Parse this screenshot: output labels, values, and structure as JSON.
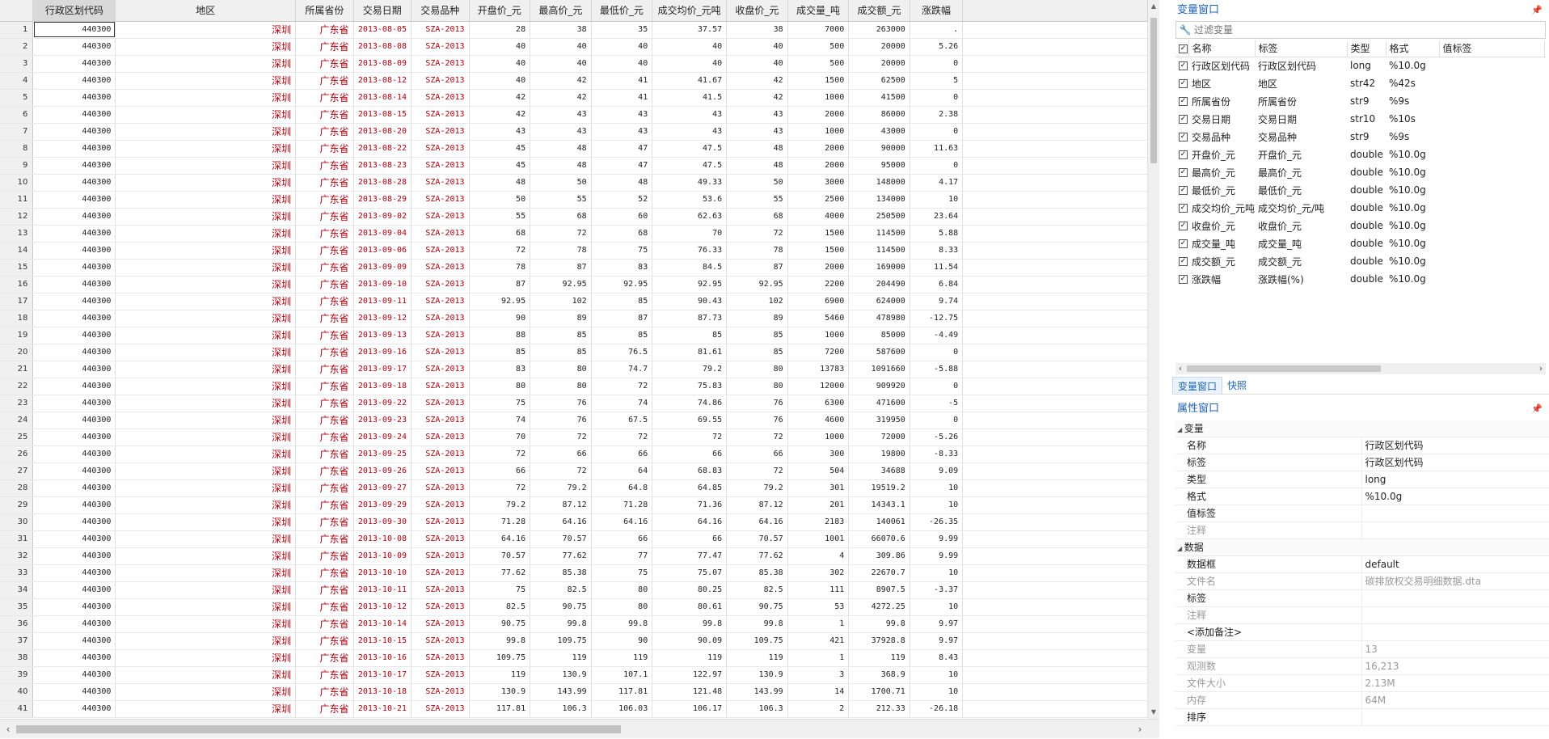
{
  "grid": {
    "columns": [
      "行政区划代码",
      "地区",
      "所属省份",
      "交易日期",
      "交易品种",
      "开盘价_元",
      "最高价_元",
      "最低价_元",
      "成交均价_元吨",
      "收盘价_元",
      "成交量_吨",
      "成交额_元",
      "涨跌幅"
    ],
    "rows": [
      [
        "1",
        "440300",
        "深圳",
        "广东省",
        "2013-08-05",
        "SZA-2013",
        "28",
        "38",
        "35",
        "37.57",
        "38",
        "7000",
        "263000",
        "."
      ],
      [
        "2",
        "440300",
        "深圳",
        "广东省",
        "2013-08-08",
        "SZA-2013",
        "40",
        "40",
        "40",
        "40",
        "40",
        "500",
        "20000",
        "5.26"
      ],
      [
        "3",
        "440300",
        "深圳",
        "广东省",
        "2013-08-09",
        "SZA-2013",
        "40",
        "40",
        "40",
        "40",
        "40",
        "500",
        "20000",
        "0"
      ],
      [
        "4",
        "440300",
        "深圳",
        "广东省",
        "2013-08-12",
        "SZA-2013",
        "40",
        "42",
        "41",
        "41.67",
        "42",
        "1500",
        "62500",
        "5"
      ],
      [
        "5",
        "440300",
        "深圳",
        "广东省",
        "2013-08-14",
        "SZA-2013",
        "42",
        "42",
        "41",
        "41.5",
        "42",
        "1000",
        "41500",
        "0"
      ],
      [
        "6",
        "440300",
        "深圳",
        "广东省",
        "2013-08-15",
        "SZA-2013",
        "42",
        "43",
        "43",
        "43",
        "43",
        "2000",
        "86000",
        "2.38"
      ],
      [
        "7",
        "440300",
        "深圳",
        "广东省",
        "2013-08-20",
        "SZA-2013",
        "43",
        "43",
        "43",
        "43",
        "43",
        "1000",
        "43000",
        "0"
      ],
      [
        "8",
        "440300",
        "深圳",
        "广东省",
        "2013-08-22",
        "SZA-2013",
        "45",
        "48",
        "47",
        "47.5",
        "48",
        "2000",
        "90000",
        "11.63"
      ],
      [
        "9",
        "440300",
        "深圳",
        "广东省",
        "2013-08-23",
        "SZA-2013",
        "45",
        "48",
        "47",
        "47.5",
        "48",
        "2000",
        "95000",
        "0"
      ],
      [
        "10",
        "440300",
        "深圳",
        "广东省",
        "2013-08-28",
        "SZA-2013",
        "48",
        "50",
        "48",
        "49.33",
        "50",
        "3000",
        "148000",
        "4.17"
      ],
      [
        "11",
        "440300",
        "深圳",
        "广东省",
        "2013-08-29",
        "SZA-2013",
        "50",
        "55",
        "52",
        "53.6",
        "55",
        "2500",
        "134000",
        "10"
      ],
      [
        "12",
        "440300",
        "深圳",
        "广东省",
        "2013-09-02",
        "SZA-2013",
        "55",
        "68",
        "60",
        "62.63",
        "68",
        "4000",
        "250500",
        "23.64"
      ],
      [
        "13",
        "440300",
        "深圳",
        "广东省",
        "2013-09-04",
        "SZA-2013",
        "68",
        "72",
        "68",
        "70",
        "72",
        "1500",
        "114500",
        "5.88"
      ],
      [
        "14",
        "440300",
        "深圳",
        "广东省",
        "2013-09-06",
        "SZA-2013",
        "72",
        "78",
        "75",
        "76.33",
        "78",
        "1500",
        "114500",
        "8.33"
      ],
      [
        "15",
        "440300",
        "深圳",
        "广东省",
        "2013-09-09",
        "SZA-2013",
        "78",
        "87",
        "83",
        "84.5",
        "87",
        "2000",
        "169000",
        "11.54"
      ],
      [
        "16",
        "440300",
        "深圳",
        "广东省",
        "2013-09-10",
        "SZA-2013",
        "87",
        "92.95",
        "92.95",
        "92.95",
        "92.95",
        "2200",
        "204490",
        "6.84"
      ],
      [
        "17",
        "440300",
        "深圳",
        "广东省",
        "2013-09-11",
        "SZA-2013",
        "92.95",
        "102",
        "85",
        "90.43",
        "102",
        "6900",
        "624000",
        "9.74"
      ],
      [
        "18",
        "440300",
        "深圳",
        "广东省",
        "2013-09-12",
        "SZA-2013",
        "90",
        "89",
        "87",
        "87.73",
        "89",
        "5460",
        "478980",
        "-12.75"
      ],
      [
        "19",
        "440300",
        "深圳",
        "广东省",
        "2013-09-13",
        "SZA-2013",
        "88",
        "85",
        "85",
        "85",
        "85",
        "1000",
        "85000",
        "-4.49"
      ],
      [
        "20",
        "440300",
        "深圳",
        "广东省",
        "2013-09-16",
        "SZA-2013",
        "85",
        "85",
        "76.5",
        "81.61",
        "85",
        "7200",
        "587600",
        "0"
      ],
      [
        "21",
        "440300",
        "深圳",
        "广东省",
        "2013-09-17",
        "SZA-2013",
        "83",
        "80",
        "74.7",
        "79.2",
        "80",
        "13783",
        "1091660",
        "-5.88"
      ],
      [
        "22",
        "440300",
        "深圳",
        "广东省",
        "2013-09-18",
        "SZA-2013",
        "80",
        "80",
        "72",
        "75.83",
        "80",
        "12000",
        "909920",
        "0"
      ],
      [
        "23",
        "440300",
        "深圳",
        "广东省",
        "2013-09-22",
        "SZA-2013",
        "75",
        "76",
        "74",
        "74.86",
        "76",
        "6300",
        "471600",
        "-5"
      ],
      [
        "24",
        "440300",
        "深圳",
        "广东省",
        "2013-09-23",
        "SZA-2013",
        "74",
        "76",
        "67.5",
        "69.55",
        "76",
        "4600",
        "319950",
        "0"
      ],
      [
        "25",
        "440300",
        "深圳",
        "广东省",
        "2013-09-24",
        "SZA-2013",
        "70",
        "72",
        "72",
        "72",
        "72",
        "1000",
        "72000",
        "-5.26"
      ],
      [
        "26",
        "440300",
        "深圳",
        "广东省",
        "2013-09-25",
        "SZA-2013",
        "72",
        "66",
        "66",
        "66",
        "66",
        "300",
        "19800",
        "-8.33"
      ],
      [
        "27",
        "440300",
        "深圳",
        "广东省",
        "2013-09-26",
        "SZA-2013",
        "66",
        "72",
        "64",
        "68.83",
        "72",
        "504",
        "34688",
        "9.09"
      ],
      [
        "28",
        "440300",
        "深圳",
        "广东省",
        "2013-09-27",
        "SZA-2013",
        "72",
        "79.2",
        "64.8",
        "64.85",
        "79.2",
        "301",
        "19519.2",
        "10"
      ],
      [
        "29",
        "440300",
        "深圳",
        "广东省",
        "2013-09-29",
        "SZA-2013",
        "79.2",
        "87.12",
        "71.28",
        "71.36",
        "87.12",
        "201",
        "14343.1",
        "10"
      ],
      [
        "30",
        "440300",
        "深圳",
        "广东省",
        "2013-09-30",
        "SZA-2013",
        "71.28",
        "64.16",
        "64.16",
        "64.16",
        "64.16",
        "2183",
        "140061",
        "-26.35"
      ],
      [
        "31",
        "440300",
        "深圳",
        "广东省",
        "2013-10-08",
        "SZA-2013",
        "64.16",
        "70.57",
        "66",
        "66",
        "70.57",
        "1001",
        "66070.6",
        "9.99"
      ],
      [
        "32",
        "440300",
        "深圳",
        "广东省",
        "2013-10-09",
        "SZA-2013",
        "70.57",
        "77.62",
        "77",
        "77.47",
        "77.62",
        "4",
        "309.86",
        "9.99"
      ],
      [
        "33",
        "440300",
        "深圳",
        "广东省",
        "2013-10-10",
        "SZA-2013",
        "77.62",
        "85.38",
        "75",
        "75.07",
        "85.38",
        "302",
        "22670.7",
        "10"
      ],
      [
        "34",
        "440300",
        "深圳",
        "广东省",
        "2013-10-11",
        "SZA-2013",
        "75",
        "82.5",
        "80",
        "80.25",
        "82.5",
        "111",
        "8907.5",
        "-3.37"
      ],
      [
        "35",
        "440300",
        "深圳",
        "广东省",
        "2013-10-12",
        "SZA-2013",
        "82.5",
        "90.75",
        "80",
        "80.61",
        "90.75",
        "53",
        "4272.25",
        "10"
      ],
      [
        "36",
        "440300",
        "深圳",
        "广东省",
        "2013-10-14",
        "SZA-2013",
        "90.75",
        "99.8",
        "99.8",
        "99.8",
        "99.8",
        "1",
        "99.8",
        "9.97"
      ],
      [
        "37",
        "440300",
        "深圳",
        "广东省",
        "2013-10-15",
        "SZA-2013",
        "99.8",
        "109.75",
        "90",
        "90.09",
        "109.75",
        "421",
        "37928.8",
        "9.97"
      ],
      [
        "38",
        "440300",
        "深圳",
        "广东省",
        "2013-10-16",
        "SZA-2013",
        "109.75",
        "119",
        "119",
        "119",
        "119",
        "1",
        "119",
        "8.43"
      ],
      [
        "39",
        "440300",
        "深圳",
        "广东省",
        "2013-10-17",
        "SZA-2013",
        "119",
        "130.9",
        "107.1",
        "122.97",
        "130.9",
        "3",
        "368.9",
        "10"
      ],
      [
        "40",
        "440300",
        "深圳",
        "广东省",
        "2013-10-18",
        "SZA-2013",
        "130.9",
        "143.99",
        "117.81",
        "121.48",
        "143.99",
        "14",
        "1700.71",
        "10"
      ],
      [
        "41",
        "440300",
        "深圳",
        "广东省",
        "2013-10-21",
        "SZA-2013",
        "117.81",
        "106.3",
        "106.03",
        "106.17",
        "106.3",
        "2",
        "212.33",
        "-26.18"
      ]
    ]
  },
  "var_window": {
    "title": "变量窗口",
    "filter_placeholder": "过滤变量",
    "headers": [
      "名称",
      "标签",
      "类型",
      "格式",
      "值标签"
    ],
    "vars": [
      [
        "行政区划代码",
        "行政区划代码",
        "long",
        "%10.0g"
      ],
      [
        "地区",
        "地区",
        "str42",
        "%42s"
      ],
      [
        "所属省份",
        "所属省份",
        "str9",
        "%9s"
      ],
      [
        "交易日期",
        "交易日期",
        "str10",
        "%10s"
      ],
      [
        "交易品种",
        "交易品种",
        "str9",
        "%9s"
      ],
      [
        "开盘价_元",
        "开盘价_元",
        "double",
        "%10.0g"
      ],
      [
        "最高价_元",
        "最高价_元",
        "double",
        "%10.0g"
      ],
      [
        "最低价_元",
        "最低价_元",
        "double",
        "%10.0g"
      ],
      [
        "成交均价_元吨",
        "成交均价_元/吨",
        "double",
        "%10.0g"
      ],
      [
        "收盘价_元",
        "收盘价_元",
        "double",
        "%10.0g"
      ],
      [
        "成交量_吨",
        "成交量_吨",
        "double",
        "%10.0g"
      ],
      [
        "成交额_元",
        "成交额_元",
        "double",
        "%10.0g"
      ],
      [
        "涨跌幅",
        "涨跌幅(%)",
        "double",
        "%10.0g"
      ]
    ]
  },
  "tabs": [
    "变量窗口",
    "快照"
  ],
  "props": {
    "title": "属性窗口",
    "sections": [
      {
        "name": "变量",
        "rows": [
          [
            "名称",
            "行政区划代码",
            false
          ],
          [
            "标签",
            "行政区划代码",
            false
          ],
          [
            "类型",
            "long",
            false
          ],
          [
            "格式",
            "%10.0g",
            false
          ],
          [
            "值标签",
            "",
            false
          ],
          [
            "注释",
            "",
            true
          ]
        ]
      },
      {
        "name": "数据",
        "rows": [
          [
            "数据框",
            "default",
            false
          ],
          [
            "文件名",
            "碳排放权交易明细数据.dta",
            true
          ],
          [
            "标签",
            "",
            false
          ],
          [
            "注释",
            "",
            true
          ],
          [
            "<添加备注>",
            "",
            false
          ],
          [
            "变量",
            "13",
            true
          ],
          [
            "观测数",
            "16,213",
            true
          ],
          [
            "文件大小",
            "2.13M",
            true
          ],
          [
            "内存",
            "64M",
            true
          ],
          [
            "排序",
            "",
            false
          ]
        ]
      }
    ]
  }
}
